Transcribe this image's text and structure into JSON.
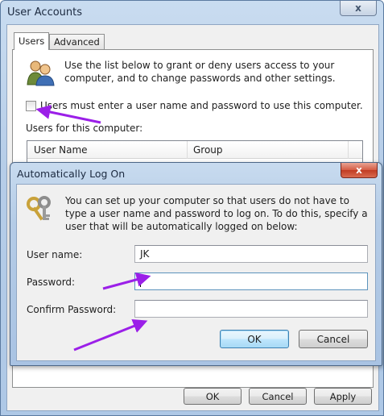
{
  "outer": {
    "title": "User Accounts",
    "close_glyph": "x",
    "tabs": [
      {
        "label": "Users"
      },
      {
        "label": "Advanced"
      }
    ],
    "intro": "Use the list below to grant or deny users access to your computer, and to change passwords and other settings.",
    "must_enter_label": "Users must enter a user name and password to use this computer.",
    "users_for_label": "Users for this computer:",
    "columns": {
      "name": "User Name",
      "group": "Group"
    },
    "buttons": {
      "ok": "OK",
      "cancel": "Cancel",
      "apply": "Apply"
    }
  },
  "dialog": {
    "title": "Automatically Log On",
    "close_glyph": "x",
    "description": "You can set up your computer so that users do not have to type a user name and password to log on. To do this, specify a user that will be automatically logged on below:",
    "fields": {
      "user_name_label": "User name:",
      "user_name_value": "JK",
      "password_label": "Password:",
      "password_value": "",
      "confirm_label": "Confirm Password:",
      "confirm_value": ""
    },
    "buttons": {
      "ok": "OK",
      "cancel": "Cancel"
    }
  },
  "colors": {
    "annotation_arrow": "#9b1fe8",
    "ok_default_border": "#3c7fb1",
    "title_close_red": "#c13c23"
  },
  "icons": [
    "users-icon",
    "keys-icon",
    "close-icon"
  ]
}
